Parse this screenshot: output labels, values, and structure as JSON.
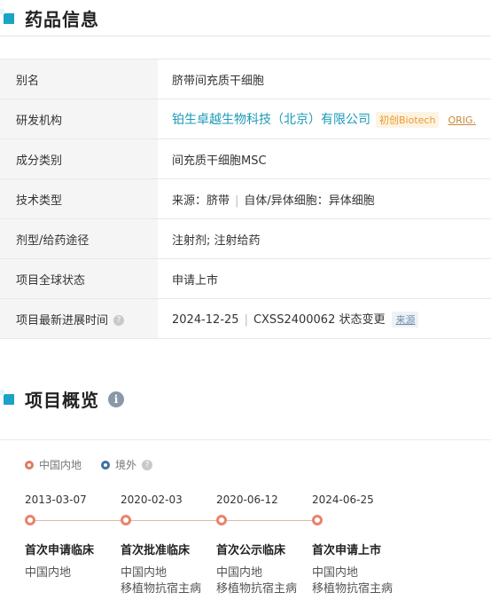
{
  "drug_info": {
    "title": "药品信息",
    "rows": [
      {
        "label": "别名",
        "value": "脐带间充质干细胞"
      },
      {
        "label": "研发机构",
        "company": "铂生卓越生物科技（北京）有限公司",
        "tag1": "初创Biotech",
        "tag2": "ORIG."
      },
      {
        "label": "成分类别",
        "value": "间充质干细胞MSC"
      },
      {
        "label": "技术类型",
        "source": "来源：脐带",
        "type": "自体/异体细胞：异体细胞"
      },
      {
        "label": "剂型/给药途径",
        "value": "注射剂; 注射给药"
      },
      {
        "label": "项目全球状态",
        "value": "申请上市"
      },
      {
        "label": "项目最新进展时间",
        "date": "2024-12-25",
        "detail": "CXSS2400062 状态变更",
        "source_link": "来源"
      }
    ]
  },
  "overview": {
    "title": "项目概览",
    "legend": {
      "mainland": "中国内地",
      "overseas": "境外"
    },
    "colors": {
      "mainland": "#e07a5f",
      "overseas": "#3f6fa3"
    },
    "timeline": [
      {
        "date": "2013-03-07",
        "event": "首次申请临床",
        "region": "中国内地",
        "indication": ""
      },
      {
        "date": "2020-02-03",
        "event": "首次批准临床",
        "region": "中国内地",
        "indication": "移植物抗宿主病"
      },
      {
        "date": "2020-06-12",
        "event": "首次公示临床",
        "region": "中国内地",
        "indication": "移植物抗宿主病"
      },
      {
        "date": "2024-06-25",
        "event": "首次申请上市",
        "region": "中国内地",
        "indication": "移植物抗宿主病"
      }
    ]
  }
}
